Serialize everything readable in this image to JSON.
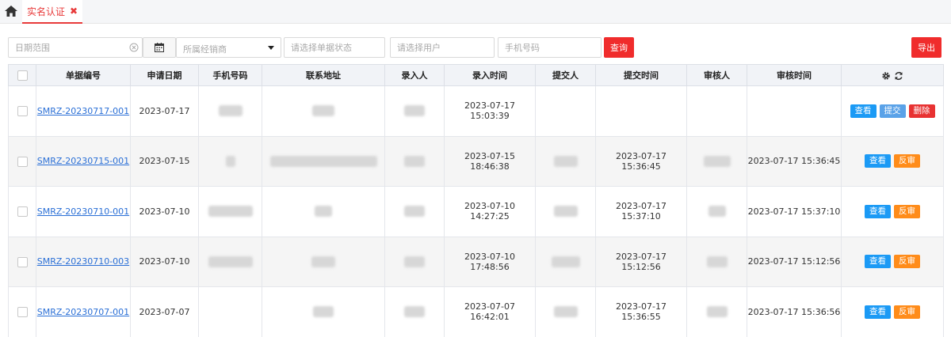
{
  "tabs": [
    {
      "label": "实名认证",
      "active": true
    }
  ],
  "filters": {
    "date_range_placeholder": "日期范围",
    "dealer_placeholder": "所属经销商",
    "status_placeholder": "请选择单据状态",
    "user_placeholder": "请选择用户",
    "phone_placeholder": "手机号码",
    "query_label": "查询",
    "export_label": "导出"
  },
  "table": {
    "headers": [
      "单据编号",
      "申请日期",
      "手机号码",
      "联系地址",
      "录入人",
      "录入时间",
      "提交人",
      "提交时间",
      "审核人",
      "审核时间"
    ],
    "rows": [
      {
        "id": "SMRZ-20230717-001",
        "date": "2023-07-17",
        "entry_time": "2023-07-17 15:03:39",
        "submit_time": "",
        "audit_time": "",
        "actions": [
          "查看",
          "提交",
          "删除"
        ]
      },
      {
        "id": "SMRZ-20230715-001",
        "date": "2023-07-15",
        "entry_time": "2023-07-15 18:46:38",
        "submit_time": "2023-07-17 15:36:45",
        "audit_time": "2023-07-17 15:36:45",
        "actions": [
          "查看",
          "反审"
        ]
      },
      {
        "id": "SMRZ-20230710-001",
        "date": "2023-07-10",
        "entry_time": "2023-07-10 14:27:25",
        "submit_time": "2023-07-17 15:37:10",
        "audit_time": "2023-07-17 15:37:10",
        "actions": [
          "查看",
          "反审"
        ]
      },
      {
        "id": "SMRZ-20230710-003",
        "date": "2023-07-10",
        "entry_time": "2023-07-10 17:48:56",
        "submit_time": "2023-07-17 15:12:56",
        "audit_time": "2023-07-17 15:12:56",
        "actions": [
          "查看",
          "反审"
        ]
      },
      {
        "id": "SMRZ-20230707-001",
        "date": "2023-07-07",
        "entry_time": "2023-07-07 16:42:01",
        "submit_time": "2023-07-17 15:36:55",
        "audit_time": "2023-07-17 15:36:56",
        "actions": [
          "查看",
          "反审"
        ]
      }
    ]
  },
  "colors": {
    "accent": "#e83a3a",
    "view": "#1b9af5",
    "submit": "#5aa2e8",
    "delete": "#e83232",
    "revoke": "#ff8c1a",
    "link": "#2a6fd6"
  },
  "icons": {
    "home": "home-icon",
    "close": "close-icon",
    "calendar": "calendar-icon",
    "clear": "clear-icon",
    "settings": "gear-icon",
    "refresh": "refresh-icon"
  }
}
